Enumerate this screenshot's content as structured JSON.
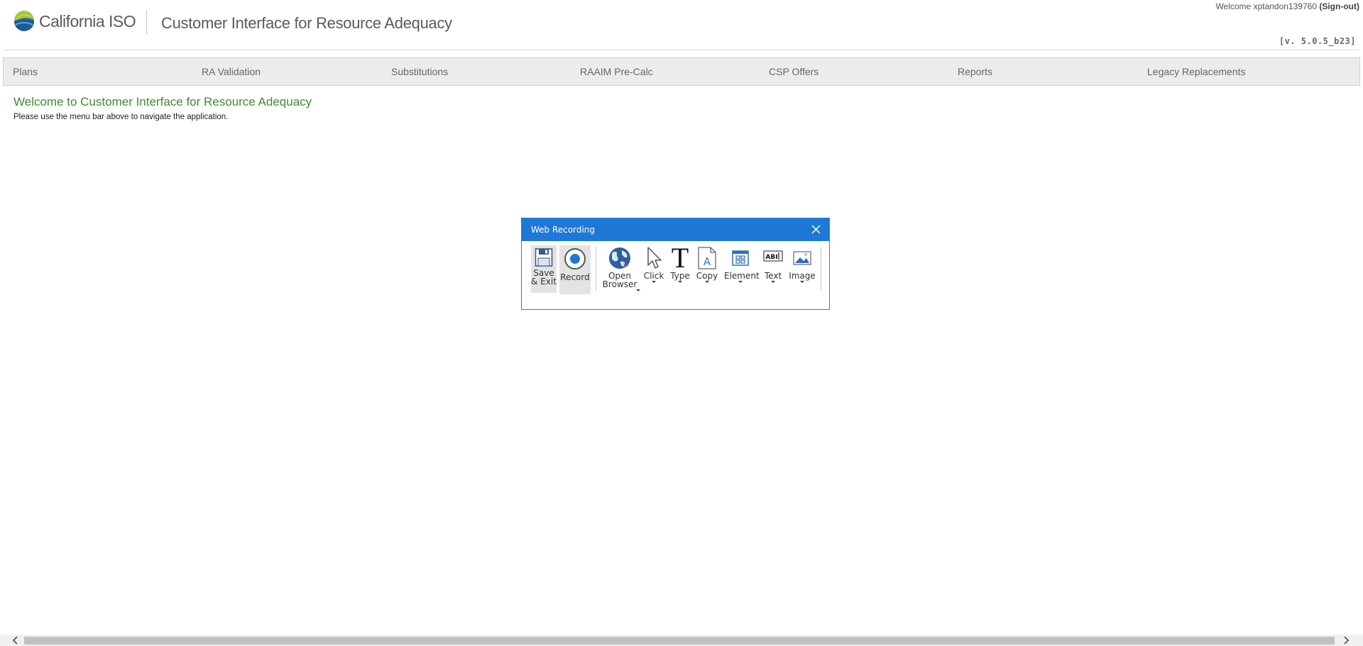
{
  "header": {
    "logo_text": "California ISO",
    "app_title": "Customer Interface for Resource Adequacy",
    "welcome_prefix": "Welcome",
    "username": "xptandon139760",
    "signout_label": "(Sign-out)",
    "version": "[v. 5.0.5_b23]"
  },
  "nav": {
    "items": [
      {
        "label": "Plans"
      },
      {
        "label": "RA Validation"
      },
      {
        "label": "Substitutions"
      },
      {
        "label": "RAAIM Pre-Calc"
      },
      {
        "label": "CSP Offers"
      },
      {
        "label": "Reports"
      },
      {
        "label": "Legacy Replacements"
      }
    ]
  },
  "content": {
    "heading": "Welcome to Customer Interface for Resource Adequacy",
    "subtext": "Please use the menu bar above to navigate the application."
  },
  "dialog": {
    "title": "Web Recording",
    "save_exit_line1": "Save",
    "save_exit_line2": "& Exit",
    "record": "Record",
    "open_browser_line1": "Open",
    "open_browser_line2": "Browser",
    "click": "Click",
    "type": "Type",
    "copy": "Copy",
    "element": "Element",
    "text": "Text",
    "image": "Image"
  },
  "colors": {
    "accent_green": "#3f8a2f",
    "dialog_blue": "#1e78d6",
    "nav_bg": "#ececec"
  }
}
